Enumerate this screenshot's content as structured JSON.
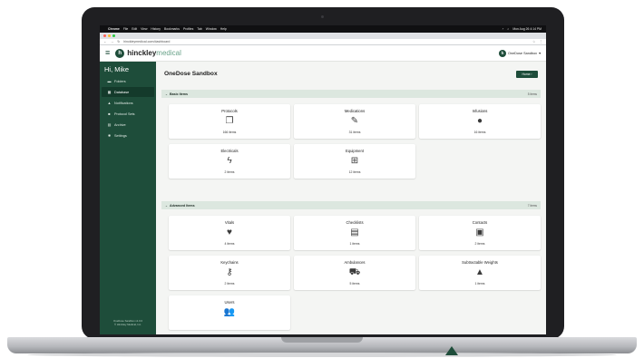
{
  "menubar": {
    "apple": "",
    "items": [
      "Chrome",
      "File",
      "Edit",
      "View",
      "History",
      "Bookmarks",
      "Profiles",
      "Tab",
      "Window",
      "Help"
    ],
    "clock": "Mon Aug 26 4:14 PM"
  },
  "browser": {
    "url": "hinckleymedical.com/dashboard"
  },
  "app": {
    "brand_main": "hinckley",
    "brand_sub": "medical",
    "org_name": "OneDose Sandbox",
    "org_initial": "h"
  },
  "sidebar": {
    "greeting": "Hi, Mike",
    "items": [
      {
        "label": "Folders",
        "icon": "folder-icon"
      },
      {
        "label": "Database",
        "icon": "database-icon"
      },
      {
        "label": "Notifications",
        "icon": "bell-icon"
      },
      {
        "label": "Protocol Sets",
        "icon": "grid-icon"
      },
      {
        "label": "Archive",
        "icon": "archive-icon"
      },
      {
        "label": "Settings",
        "icon": "gear-icon"
      }
    ],
    "footer_line1": "OneDose Sandbox v1.0.0",
    "footer_line2": "© Hinckley Medical, Inc."
  },
  "main": {
    "title": "OneDose Sandbox",
    "home_button": "Home",
    "basic": {
      "label": "Basic Items",
      "count": "5 items",
      "cards": [
        {
          "title": "Protocols",
          "icon": "document-copy-icon",
          "count": "166 items"
        },
        {
          "title": "Medications",
          "icon": "syringe-icon",
          "count": "31 items"
        },
        {
          "title": "Infusions",
          "icon": "drop-icon",
          "count": "16 items"
        },
        {
          "title": "Electricals",
          "icon": "lightning-icon",
          "count": "2 items"
        },
        {
          "title": "Equipment",
          "icon": "medkit-icon",
          "count": "12 items"
        }
      ]
    },
    "advanced": {
      "label": "Advanced Items",
      "count": "7 items",
      "cards": [
        {
          "title": "Vitals",
          "icon": "heart-icon",
          "count": "4 items"
        },
        {
          "title": "Checklists",
          "icon": "checklist-icon",
          "count": "1 items"
        },
        {
          "title": "Contacts",
          "icon": "contact-card-icon",
          "count": "2 items"
        },
        {
          "title": "Keychains",
          "icon": "key-icon",
          "count": "2 items"
        },
        {
          "title": "Ambulances",
          "icon": "ambulance-icon",
          "count": "5 items"
        },
        {
          "title": "Subtractable Weights",
          "icon": "weight-icon",
          "count": "1 items"
        },
        {
          "title": "Users",
          "icon": "users-icon",
          "count": ""
        }
      ]
    }
  },
  "colors": {
    "brand_green": "#1e4d3a",
    "section_bg": "#dce7df"
  }
}
